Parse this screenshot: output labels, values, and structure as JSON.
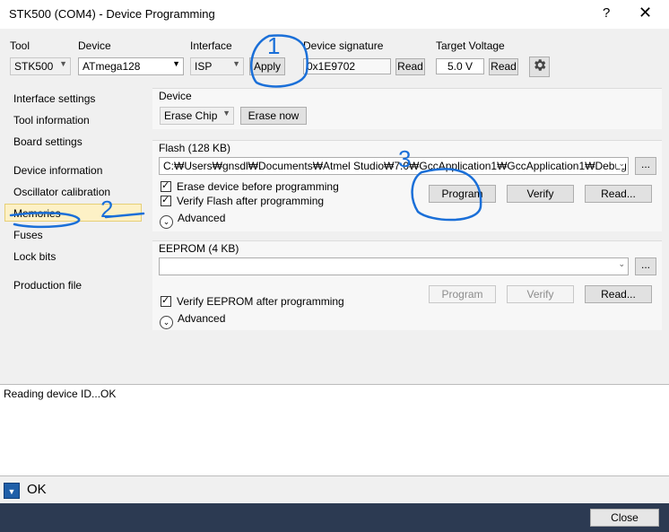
{
  "window": {
    "title": "STK500 (COM4) - Device Programming",
    "help": "?",
    "close": "✕"
  },
  "toolbar": {
    "tool_label": "Tool",
    "tool_value": "STK500",
    "device_label": "Device",
    "device_value": "ATmega128",
    "interface_label": "Interface",
    "interface_value": "ISP",
    "apply_label": "Apply",
    "signature_label": "Device signature",
    "signature_value": "0x1E9702",
    "signature_read": "Read",
    "voltage_label": "Target Voltage",
    "voltage_value": "5.0 V",
    "voltage_read": "Read"
  },
  "sidebar": {
    "items": [
      "Interface settings",
      "Tool information",
      "Board settings",
      "Device information",
      "Oscillator calibration",
      "Memories",
      "Fuses",
      "Lock bits",
      "Production file"
    ],
    "selected": "Memories"
  },
  "device_group": {
    "title": "Device",
    "erase_select": "Erase Chip",
    "erase_now": "Erase now"
  },
  "flash_group": {
    "title": "Flash (128 KB)",
    "path": "C:₩Users₩gnsdl₩Documents₩Atmel Studio₩7.0₩GccApplication1₩GccApplication1₩Debug",
    "browse": "...",
    "erase_before": "Erase device before programming",
    "verify_after": "Verify Flash after programming",
    "program": "Program",
    "verify": "Verify",
    "read": "Read...",
    "advanced": "Advanced"
  },
  "eeprom_group": {
    "title": "EEPROM (4 KB)",
    "path": "",
    "browse": "...",
    "verify_after": "Verify EEPROM after programming",
    "program": "Program",
    "verify": "Verify",
    "read": "Read...",
    "advanced": "Advanced"
  },
  "log": {
    "line": "Reading device ID...OK"
  },
  "status": {
    "text": "OK"
  },
  "footer": {
    "close": "Close"
  },
  "annotations": {
    "n1": "1",
    "n2": "2",
    "n3": "3"
  },
  "colors": {
    "annotation": "#1a6fd8",
    "footer": "#2c3a52",
    "selected_bg": "#fdf1c6"
  }
}
